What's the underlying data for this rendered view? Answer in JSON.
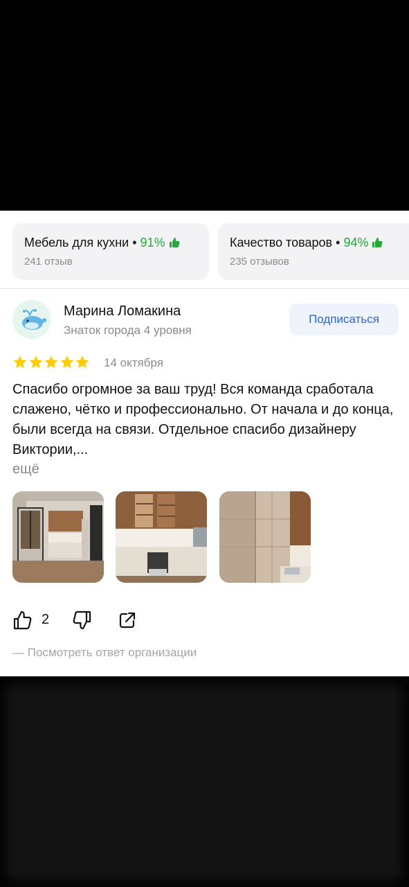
{
  "aspects": [
    {
      "name": "Мебель для кухни",
      "separator": "•",
      "percent": "91%",
      "reviews": "241 отзыв",
      "icon": "thumbs-up-icon",
      "color": "#26a83a"
    },
    {
      "name": "Качество товаров",
      "separator": "•",
      "percent": "94%",
      "reviews": "235 отзывов",
      "icon": "thumbs-up-icon",
      "color": "#26a83a"
    }
  ],
  "review": {
    "author": {
      "name": "Марина Ломакина",
      "level": "Знаток города 4 уровня",
      "avatar_icon": "whale-avatar"
    },
    "subscribe_label": "Подписаться",
    "rating": 5,
    "date": "14 октября",
    "text": "Спасибо огромное за ваш труд! Вся команда сработала слажено, чётко и профессионально. От начала и до конца, были всегда на связи. Отдельное спасибо дизайнеру Виктории,...",
    "more_label": "ещё",
    "photos": [
      "kitchen-photo-1",
      "kitchen-photo-2",
      "kitchen-photo-3"
    ],
    "likes": "2",
    "reply_link": "— Посмотреть ответ организации"
  },
  "colors": {
    "star": "#fc0",
    "accent": "#2a67d6",
    "positive": "#26a83a",
    "muted": "#8a8a8a"
  }
}
